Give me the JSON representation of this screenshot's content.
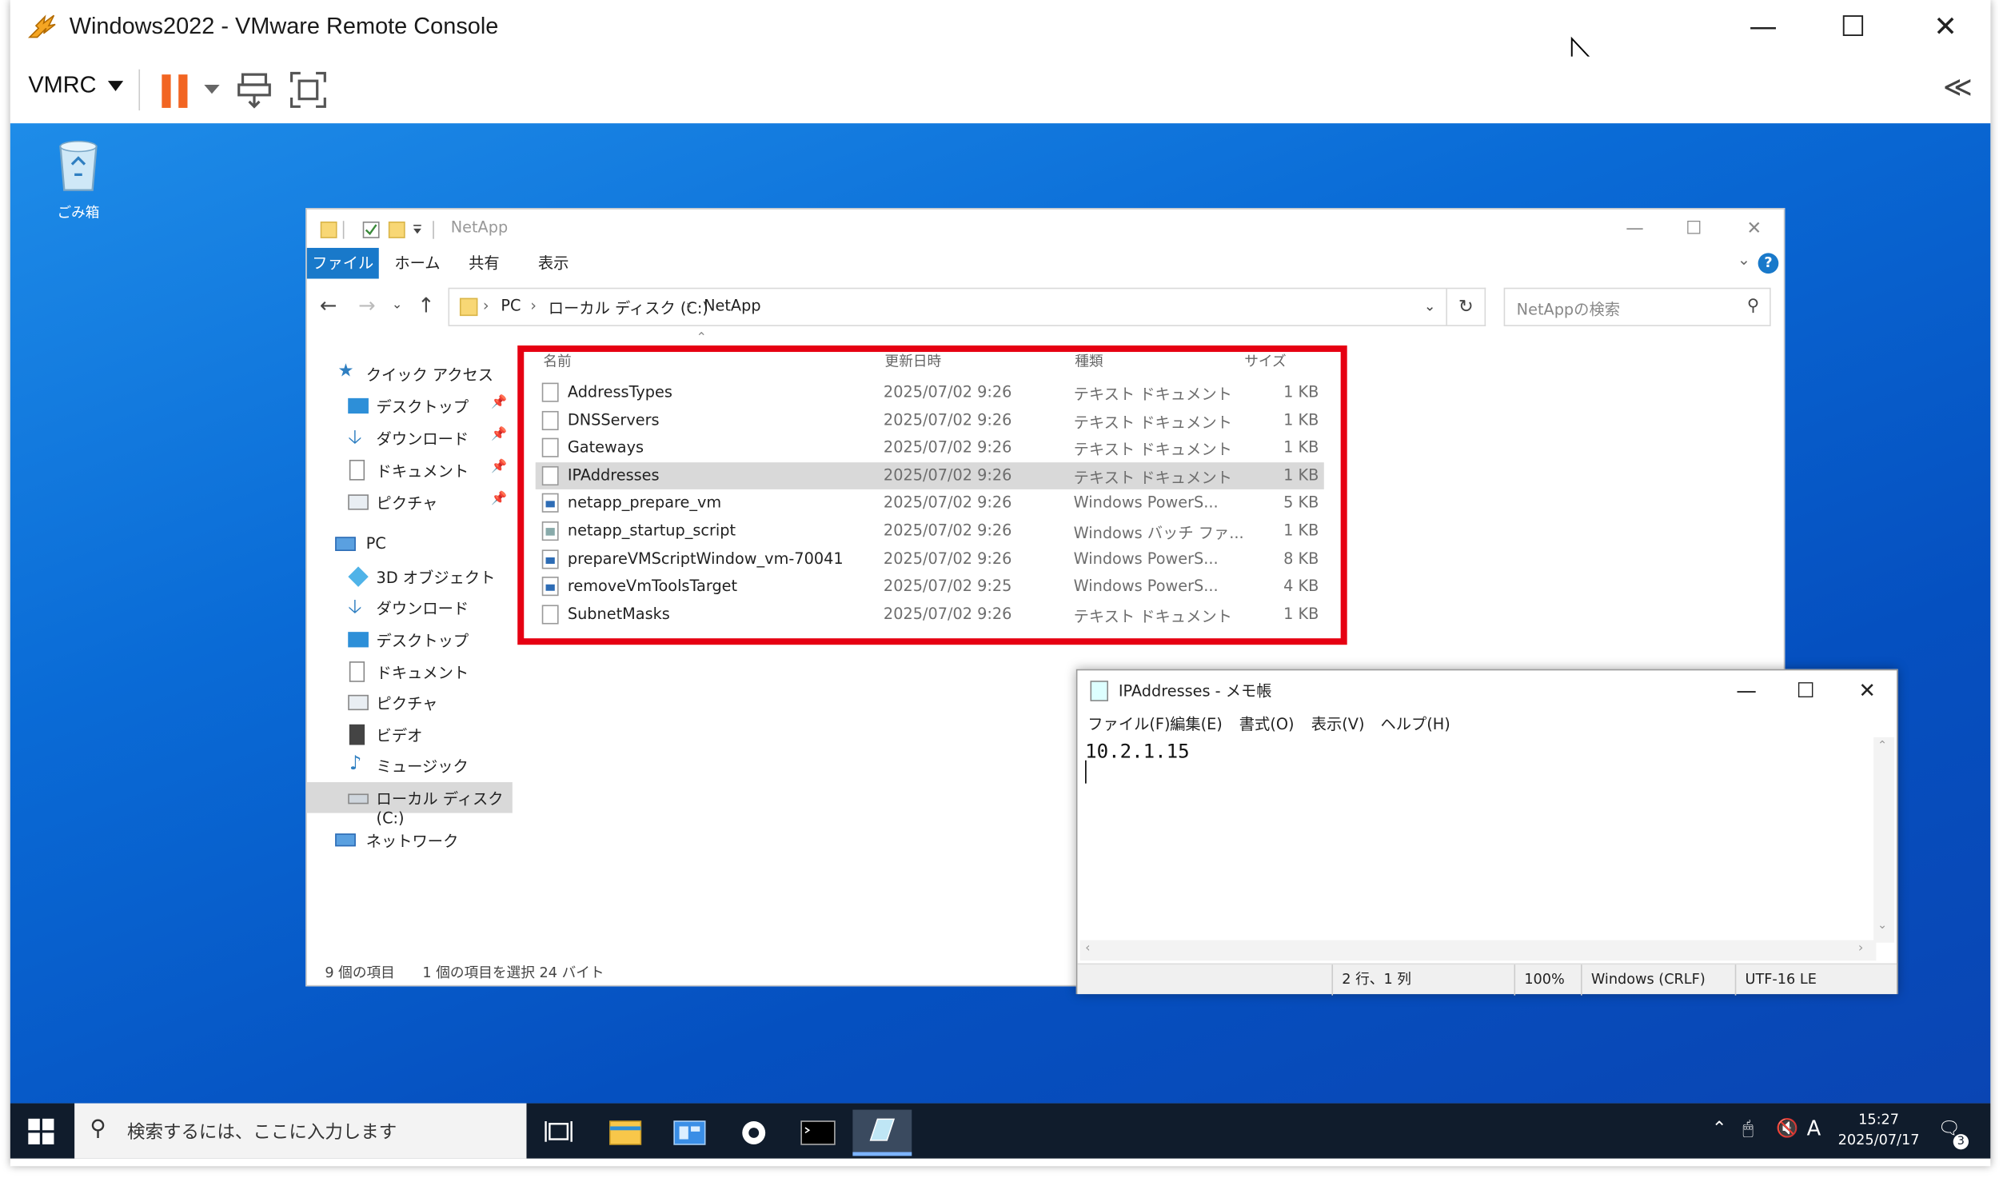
{
  "vmrc": {
    "title": "Windows2022 - VMware Remote Console",
    "menu_label": "VMRC",
    "collapse": "≪"
  },
  "desktop": {
    "recycle_bin": "ごみ箱"
  },
  "explorer": {
    "title": "NetApp",
    "tabs": [
      "ファイル",
      "ホーム",
      "共有",
      "表示"
    ],
    "breadcrumb": [
      "PC",
      "ローカル ディスク (C:)",
      "NetApp"
    ],
    "search_placeholder": "NetAppの検索",
    "nav": {
      "quick_access": "クイック アクセス",
      "qa_items": [
        "デスクトップ",
        "ダウンロード",
        "ドキュメント",
        "ピクチャ"
      ],
      "pc": "PC",
      "pc_items": [
        "3D オブジェクト",
        "ダウンロード",
        "デスクトップ",
        "ドキュメント",
        "ピクチャ",
        "ビデオ",
        "ミュージック",
        "ローカル ディスク (C:)"
      ],
      "network": "ネットワーク"
    },
    "columns": [
      "名前",
      "更新日時",
      "種類",
      "サイズ"
    ],
    "files": [
      {
        "name": "AddressTypes",
        "date": "2025/07/02 9:26",
        "type": "テキスト ドキュメント",
        "size": "1 KB",
        "icon": "text"
      },
      {
        "name": "DNSServers",
        "date": "2025/07/02 9:26",
        "type": "テキスト ドキュメント",
        "size": "1 KB",
        "icon": "text"
      },
      {
        "name": "Gateways",
        "date": "2025/07/02 9:26",
        "type": "テキスト ドキュメント",
        "size": "1 KB",
        "icon": "text"
      },
      {
        "name": "IPAddresses",
        "date": "2025/07/02 9:26",
        "type": "テキスト ドキュメント",
        "size": "1 KB",
        "icon": "text",
        "selected": true
      },
      {
        "name": "netapp_prepare_vm",
        "date": "2025/07/02 9:26",
        "type": "Windows PowerS...",
        "size": "5 KB",
        "icon": "ps"
      },
      {
        "name": "netapp_startup_script",
        "date": "2025/07/02 9:26",
        "type": "Windows バッチ ファ...",
        "size": "1 KB",
        "icon": "bat"
      },
      {
        "name": "prepareVMScriptWindow_vm-70041",
        "date": "2025/07/02 9:26",
        "type": "Windows PowerS...",
        "size": "8 KB",
        "icon": "ps"
      },
      {
        "name": "removeVmToolsTarget",
        "date": "2025/07/02 9:25",
        "type": "Windows PowerS...",
        "size": "4 KB",
        "icon": "ps"
      },
      {
        "name": "SubnetMasks",
        "date": "2025/07/02 9:26",
        "type": "テキスト ドキュメント",
        "size": "1 KB",
        "icon": "text"
      }
    ],
    "status_count": "9 個の項目",
    "status_selected": "1 個の項目を選択  24 バイト",
    "highlight_color": "#e60012"
  },
  "notepad": {
    "title": "IPAddresses - メモ帳",
    "menu": [
      "ファイル(F)",
      "編集(E)",
      "書式(O)",
      "表示(V)",
      "ヘルプ(H)"
    ],
    "content": "10.2.1.15",
    "status": {
      "position": "2 行、1 列",
      "zoom": "100%",
      "line_ending": "Windows (CRLF)",
      "encoding": "UTF-16 LE"
    }
  },
  "taskbar": {
    "search_placeholder": "検索するには、ここに入力します",
    "ime": "A",
    "time": "15:27",
    "date": "2025/07/17",
    "notification_count": "3"
  }
}
